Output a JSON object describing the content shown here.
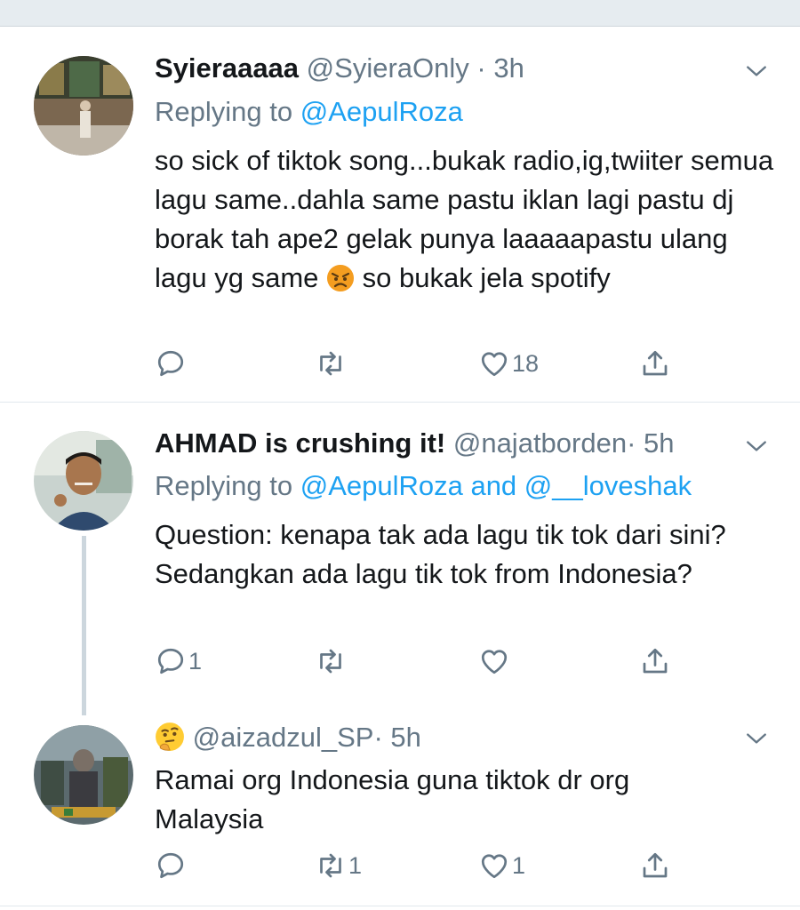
{
  "tweets": [
    {
      "name": "Syieraaaaa",
      "handle": "@SyieraOnly",
      "dot": "·",
      "time": "3h",
      "replying_prefix": "Replying to ",
      "replying_mentions": "@AepulRoza",
      "text_before_emoji": "so sick of tiktok song...bukak radio,ig,twiiter semua lagu same..dahla same pastu iklan lagi pastu dj borak tah ape2 gelak punya laaaaapastu ulang lagu yg same ",
      "emoji": "angry-face-icon",
      "text_after_emoji": " so bukak jela spotify",
      "reply_count": "",
      "retweet_count": "",
      "like_count": "18"
    },
    {
      "name": "AHMAD is crushing it!",
      "handle": "@najatborden",
      "dot": "·",
      "time": "5h",
      "replying_prefix": "Replying to ",
      "replying_mentions": "@AepulRoza and @__loveshak",
      "text": "Question: kenapa tak ada lagu tik tok dari sini? Sedangkan ada lagu tik tok from Indonesia?",
      "reply_count": "1",
      "retweet_count": "",
      "like_count": ""
    },
    {
      "name_emoji": "thinking-face-icon",
      "handle": "@aizadzul_SP",
      "dot": "·",
      "time": "5h",
      "text": "Ramai org Indonesia guna tiktok dr org Malaysia",
      "reply_count": "",
      "retweet_count": "1",
      "like_count": "1"
    }
  ],
  "colors": {
    "text": "#14171a",
    "muted": "#657786",
    "link": "#1da1f2",
    "divider": "#e1e8ed",
    "thread_line": "#ccd6dd"
  }
}
